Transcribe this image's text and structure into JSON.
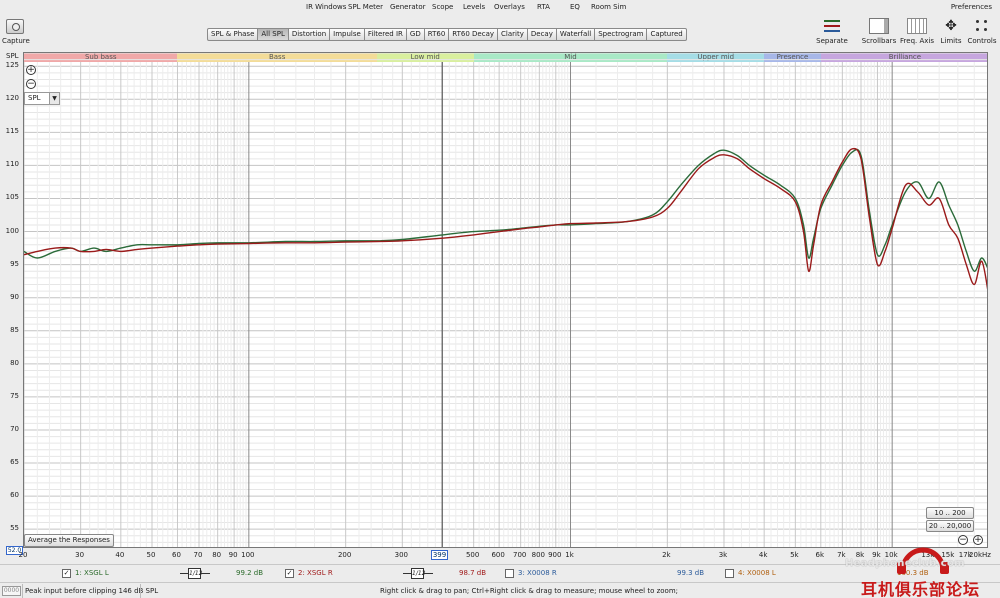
{
  "menu": [
    "IR Windows",
    "SPL Meter",
    "Generator",
    "Scope",
    "Levels",
    "Overlays",
    "RTA",
    "EQ",
    "Room Sim"
  ],
  "preferences_label": "Preferences",
  "capture_label": "Capture",
  "tabs": [
    {
      "label": "SPL & Phase",
      "active": false
    },
    {
      "label": "All SPL",
      "active": true
    },
    {
      "label": "Distortion",
      "active": false
    },
    {
      "label": "Impulse",
      "active": false
    },
    {
      "label": "Filtered IR",
      "active": false
    },
    {
      "label": "GD",
      "active": false
    },
    {
      "label": "RT60",
      "active": false
    },
    {
      "label": "RT60 Decay",
      "active": false
    },
    {
      "label": "Clarity",
      "active": false
    },
    {
      "label": "Decay",
      "active": false
    },
    {
      "label": "Waterfall",
      "active": false
    },
    {
      "label": "Spectrogram",
      "active": false
    },
    {
      "label": "Captured",
      "active": false
    }
  ],
  "tools": {
    "separate": "Separate",
    "scrollbars": "Scrollbars",
    "freq_axis": "Freq. Axis",
    "limits": "Limits",
    "controls": "Controls"
  },
  "y_unit": "SPL",
  "spl_select": "SPL",
  "y_min_box": "52.0",
  "cursor_box": "399",
  "avg_button": "Average the Responses",
  "range_buttons": [
    "10 .. 200",
    "20 .. 20,000"
  ],
  "bands": [
    {
      "label": "Sub bass",
      "from": 20,
      "to": 60,
      "color": "#f0a8a8"
    },
    {
      "label": "Bass",
      "from": 60,
      "to": 250,
      "color": "#f3dc98"
    },
    {
      "label": "Low mid",
      "from": 250,
      "to": 500,
      "color": "#d9ef9e"
    },
    {
      "label": "Mid",
      "from": 500,
      "to": 2000,
      "color": "#a9e9c6"
    },
    {
      "label": "Upper mid",
      "from": 2000,
      "to": 4000,
      "color": "#a5dde6"
    },
    {
      "label": "Presence",
      "from": 4000,
      "to": 6000,
      "color": "#a7b7e8"
    },
    {
      "label": "Brilliance",
      "from": 6000,
      "to": 20000,
      "color": "#c6a6de"
    }
  ],
  "x_tick_labels": [
    "20",
    "30",
    "40",
    "50",
    "60",
    "70",
    "80",
    "90",
    "100",
    "200",
    "300",
    "500",
    "600",
    "700",
    "800",
    "900",
    "1k",
    "2k",
    "3k",
    "4k",
    "5k",
    "6k",
    "7k",
    "8k",
    "9k",
    "10k",
    "13k",
    "15k",
    "17k",
    "20kHz"
  ],
  "measurements": [
    {
      "index": "1: XSGL L",
      "checked": true,
      "value": "99.2 dB",
      "color": "#2b6b2b",
      "smoothing": "1/12"
    },
    {
      "index": "2: XSGL R",
      "checked": true,
      "value": "98.7 dB",
      "color": "#a01a1a",
      "smoothing": "1/12"
    },
    {
      "index": "3: X0008 R",
      "checked": false,
      "value": "99.3 dB",
      "color": "#2a5a9a",
      "smoothing": ""
    },
    {
      "index": "4: X0008 L",
      "checked": false,
      "value": "100.3 dB",
      "color": "#b06010",
      "smoothing": ""
    }
  ],
  "status": {
    "code": "0000",
    "left": "Peak input before clipping 146 dB SPL",
    "middle": "Right click & drag to pan; Ctrl+Right click & drag to measure; mouse wheel to zoom;"
  },
  "watermark": {
    "url": "Headphoneclub.com",
    "text": "耳机俱乐部论坛"
  },
  "chart_data": {
    "type": "line",
    "xscale": "log",
    "xlim": [
      20,
      20000
    ],
    "ylim": [
      52,
      127
    ],
    "ylabel": "SPL",
    "y_ticks": [
      55,
      60,
      65,
      70,
      75,
      80,
      85,
      90,
      95,
      100,
      105,
      110,
      115,
      120,
      125
    ],
    "cursor_x": 399,
    "series": [
      {
        "name": "1: XSGL L",
        "color": "#2b6b3a",
        "x": [
          20,
          22,
          25,
          28,
          30,
          33,
          36,
          40,
          45,
          50,
          60,
          70,
          80,
          100,
          130,
          160,
          200,
          250,
          300,
          400,
          500,
          600,
          700,
          800,
          900,
          1000,
          1200,
          1500,
          1800,
          2000,
          2200,
          2500,
          2800,
          3000,
          3300,
          3600,
          4000,
          4500,
          5000,
          5300,
          5500,
          5700,
          6000,
          6500,
          7000,
          7500,
          8000,
          8500,
          9000,
          9500,
          10000,
          11000,
          12000,
          13000,
          14000,
          15000,
          16000,
          17000,
          18000,
          19000,
          20000
        ],
        "y": [
          97,
          96,
          97,
          97.5,
          97,
          97.5,
          97,
          97.5,
          98,
          98,
          98,
          98.2,
          98.3,
          98.3,
          98.5,
          98.5,
          98.6,
          98.6,
          98.8,
          99.5,
          100,
          100.2,
          100.5,
          100.8,
          101,
          101,
          101.2,
          101.5,
          102.5,
          104.5,
          107,
          110,
          111.8,
          112.3,
          111.5,
          110,
          108.5,
          107,
          105,
          101,
          96,
          99,
          103.5,
          107,
          110,
          112,
          111.5,
          103,
          96.5,
          98,
          101,
          106,
          107.5,
          105,
          107.5,
          104,
          101,
          97,
          94,
          96,
          94
        ]
      },
      {
        "name": "2: XSGL R",
        "color": "#9a1a1a",
        "x": [
          20,
          22,
          25,
          28,
          30,
          33,
          36,
          40,
          45,
          50,
          60,
          70,
          80,
          100,
          130,
          160,
          200,
          250,
          300,
          400,
          500,
          600,
          700,
          800,
          900,
          1000,
          1200,
          1500,
          1800,
          2000,
          2200,
          2500,
          2800,
          3000,
          3300,
          3600,
          4000,
          4500,
          5000,
          5300,
          5500,
          5700,
          6000,
          6500,
          7000,
          7500,
          8000,
          8500,
          9000,
          9500,
          10000,
          11000,
          12000,
          13000,
          14000,
          15000,
          16000,
          17000,
          18000,
          19000,
          20000
        ],
        "y": [
          96.5,
          97,
          97.5,
          97.5,
          97,
          97,
          97.3,
          97,
          97.3,
          97.5,
          97.8,
          98,
          98.1,
          98.2,
          98.3,
          98.3,
          98.4,
          98.5,
          98.6,
          99,
          99.5,
          100,
          100.4,
          100.7,
          101,
          101.2,
          101.3,
          101.5,
          102.2,
          103.5,
          106,
          109.5,
          111.2,
          111.6,
          111,
          109.5,
          108,
          106.5,
          104.5,
          100,
          94,
          98,
          104,
          107.5,
          110.5,
          112.5,
          111,
          102,
          95,
          97,
          100.5,
          107,
          106,
          104,
          105,
          101,
          99,
          95,
          92,
          95.5,
          90
        ]
      }
    ]
  }
}
